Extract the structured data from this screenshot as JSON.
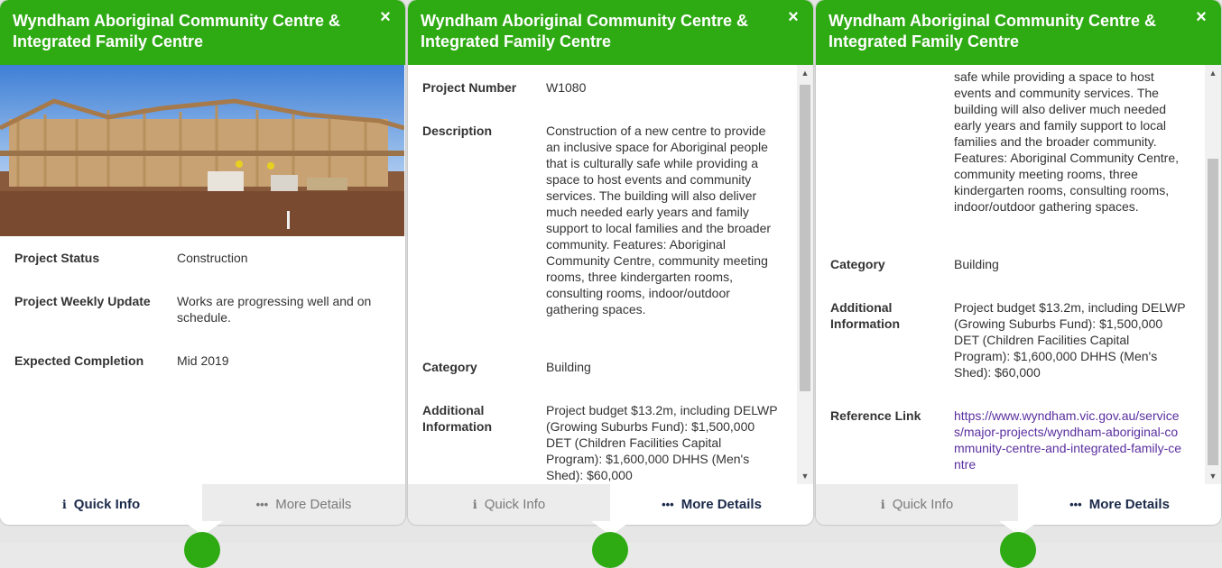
{
  "colors": {
    "header": "#2eaa13",
    "link": "#5a2fa0",
    "tab_active_text": "#1c2a4a"
  },
  "panels": [
    {
      "title": "Wyndham Aboriginal Community Centre & Integrated Family Centre",
      "close_icon": "×",
      "rows": [
        {
          "label": "Project Status",
          "value": "Construction"
        },
        {
          "label": "Project Weekly Update",
          "value": "Works are progressing well and on schedule."
        },
        {
          "label": "Expected Completion",
          "value": "Mid 2019"
        }
      ],
      "tabs": {
        "quick_info": "Quick Info",
        "more_details": "More Details",
        "active": "quick_info"
      }
    },
    {
      "title": "Wyndham Aboriginal Community Centre & Integrated Family Centre",
      "close_icon": "×",
      "rows": [
        {
          "label": "Project Number",
          "value": "W1080"
        },
        {
          "label": "Description",
          "value": "Construction of a new centre to provide an inclusive space for Aboriginal people that is culturally safe while providing a space to host events and community services. The building will also deliver much needed early years and family support to local families and the broader community. Features: Aboriginal Community Centre, community meeting rooms, three kindergarten rooms, consulting rooms, indoor/outdoor gathering spaces."
        },
        {
          "label": "Category",
          "value": "Building"
        },
        {
          "label": "Additional Information",
          "value": "Project budget $13.2m, including DELWP (Growing Suburbs Fund): $1,500,000 DET (Children Facilities Capital Program): $1,600,000 DHHS (Men's Shed): $60,000"
        }
      ],
      "tabs": {
        "quick_info": "Quick Info",
        "more_details": "More Details",
        "active": "more_details"
      }
    },
    {
      "title": "Wyndham Aboriginal Community Centre & Integrated Family Centre",
      "close_icon": "×",
      "rows": [
        {
          "label": "",
          "value": "safe while providing a space to host events and community services. The building will also deliver much needed early years and family support to local families and the broader community. Features: Aboriginal Community Centre, community meeting rooms, three kindergarten rooms, consulting rooms, indoor/outdoor gathering spaces."
        },
        {
          "label": "Category",
          "value": "Building"
        },
        {
          "label": "Additional Information",
          "value": "Project budget $13.2m, including DELWP (Growing Suburbs Fund): $1,500,000 DET (Children Facilities Capital Program): $1,600,000 DHHS (Men's Shed): $60,000"
        },
        {
          "label": "Reference Link",
          "value": "https://www.wyndham.vic.gov.au/services/major-projects/wyndham-aboriginal-community-centre-and-integrated-family-centre"
        }
      ],
      "tabs": {
        "quick_info": "Quick Info",
        "more_details": "More Details",
        "active": "more_details"
      }
    }
  ]
}
